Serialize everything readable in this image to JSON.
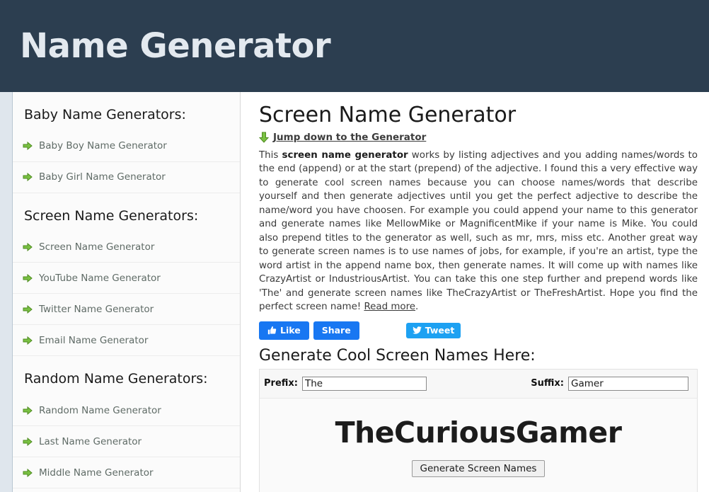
{
  "header": {
    "title": "Name Generator",
    "background_color": "#2c3e50",
    "title_color": "#e3e9ef"
  },
  "sidebar": {
    "groups": [
      {
        "title": "Baby Name Generators:",
        "items": [
          {
            "label": "Baby Boy Name Generator",
            "icon": "green-arrow-icon"
          },
          {
            "label": "Baby Girl Name Generator",
            "icon": "green-arrow-icon"
          }
        ]
      },
      {
        "title": "Screen Name Generators:",
        "items": [
          {
            "label": "Screen Name Generator",
            "icon": "green-arrow-icon"
          },
          {
            "label": "YouTube Name Generator",
            "icon": "green-arrow-icon"
          },
          {
            "label": "Twitter Name Generator",
            "icon": "green-arrow-icon"
          },
          {
            "label": "Email Name Generator",
            "icon": "green-arrow-icon"
          }
        ]
      },
      {
        "title": "Random Name Generators:",
        "items": [
          {
            "label": "Random Name Generator",
            "icon": "green-arrow-icon"
          },
          {
            "label": "Last Name Generator",
            "icon": "green-arrow-icon"
          },
          {
            "label": "Middle Name Generator",
            "icon": "green-arrow-icon"
          }
        ]
      }
    ]
  },
  "main": {
    "title": "Screen Name Generator",
    "jump_link": "Jump down to the Generator",
    "jump_icon": "green-down-arrow-icon",
    "intro": {
      "part1": "This ",
      "bold": "screen name generator",
      "part2": " works by listing adjectives and you adding names/words to the end (append) or at the start (prepend) of the adjective. I found this a very effective way to generate cool screen names because you can choose names/words that describe yourself and then generate adjectives until you get the perfect adjective to describe the name/word you have choosen. For example you could append your name to this generator and generate names like MellowMike or MagnificentMike if your name is Mike. You could also prepend titles to the generator as well, such as mr, mrs, miss etc. Another great way to generate screen names is to use names of jobs, for example, if you're an artist, type the word artist in the append name box, then generate names. It will come up with names like CrazyArtist or IndustriousArtist. You can take this one step further and prepend words like 'The' and generate screen names like TheCrazyArtist or TheFreshArtist. Hope you find the perfect screen name! ",
      "read_more": "Read more",
      "part3": "."
    },
    "social": {
      "facebook_like": "Like",
      "facebook_share": "Share",
      "twitter_tweet": "Tweet",
      "facebook_color": "#1877f2",
      "twitter_color": "#1da1f2"
    },
    "generator": {
      "title": "Generate Cool Screen Names Here:",
      "prefix_label": "Prefix:",
      "prefix_value": "The",
      "prefix_placeholder": "",
      "suffix_label": "Suffix:",
      "suffix_value": "Gamer",
      "suffix_placeholder": "",
      "result": "TheCuriousGamer",
      "button_label": "Generate Screen Names"
    }
  }
}
